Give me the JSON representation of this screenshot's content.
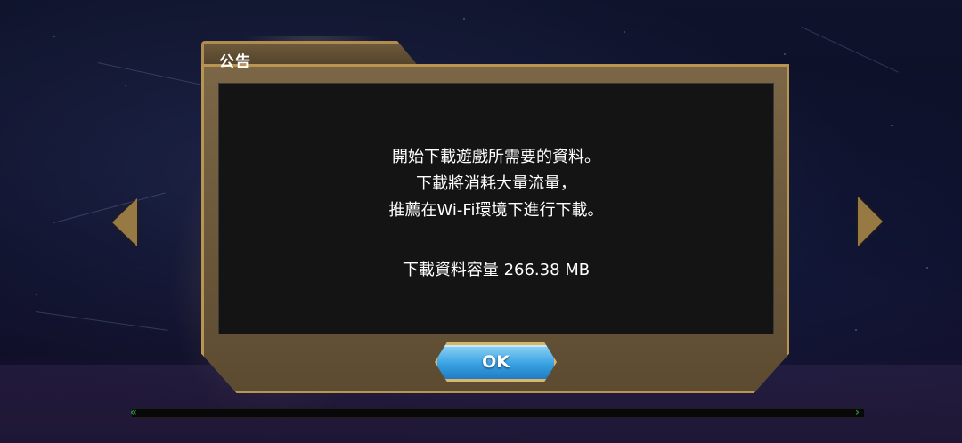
{
  "dialog": {
    "title": "公告",
    "message_lines": [
      "開始下載遊戲所需要的資料。",
      "下載將消耗大量流量，",
      "推薦在Wi-Fi環境下進行下載。"
    ],
    "download_size": "下載資料容量 266.38 MB",
    "ok_label": "OK"
  },
  "colors": {
    "frame_gold": "#b89552",
    "button_blue": "#3aa2e2",
    "progress_green": "#3fbf5f"
  },
  "icons": {
    "left_nav": "chevron-left-icon",
    "right_nav": "chevron-right-icon"
  }
}
